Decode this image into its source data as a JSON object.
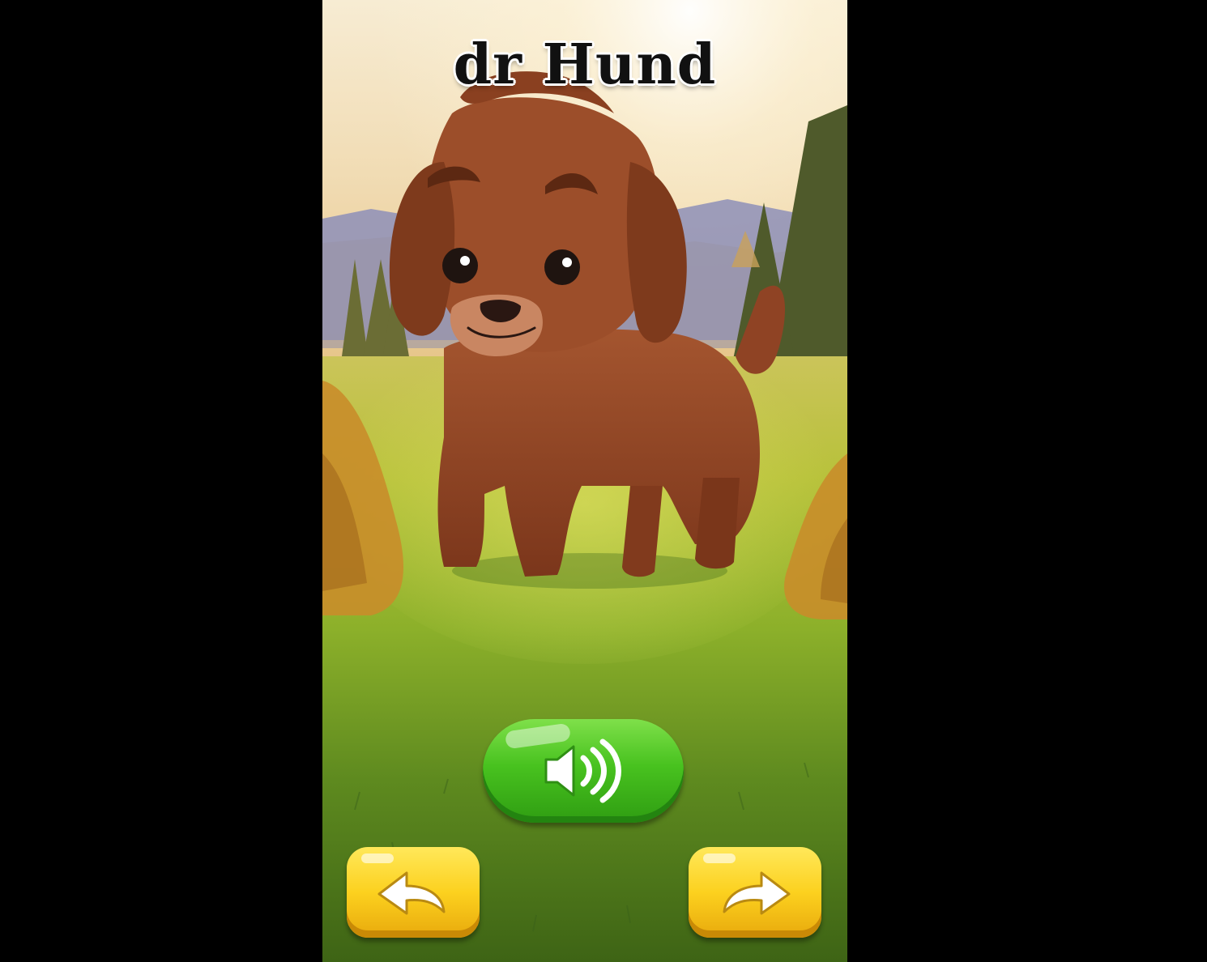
{
  "screen": {
    "title": "dr Hund"
  },
  "controls": {
    "sound_icon": "speaker-sound-icon",
    "back_icon": "curved-arrow-left-icon",
    "next_icon": "curved-arrow-right-icon"
  },
  "colors": {
    "sound_button": "#48c21f",
    "nav_button": "#fcd11f",
    "dog_fur": "#8e4223"
  }
}
